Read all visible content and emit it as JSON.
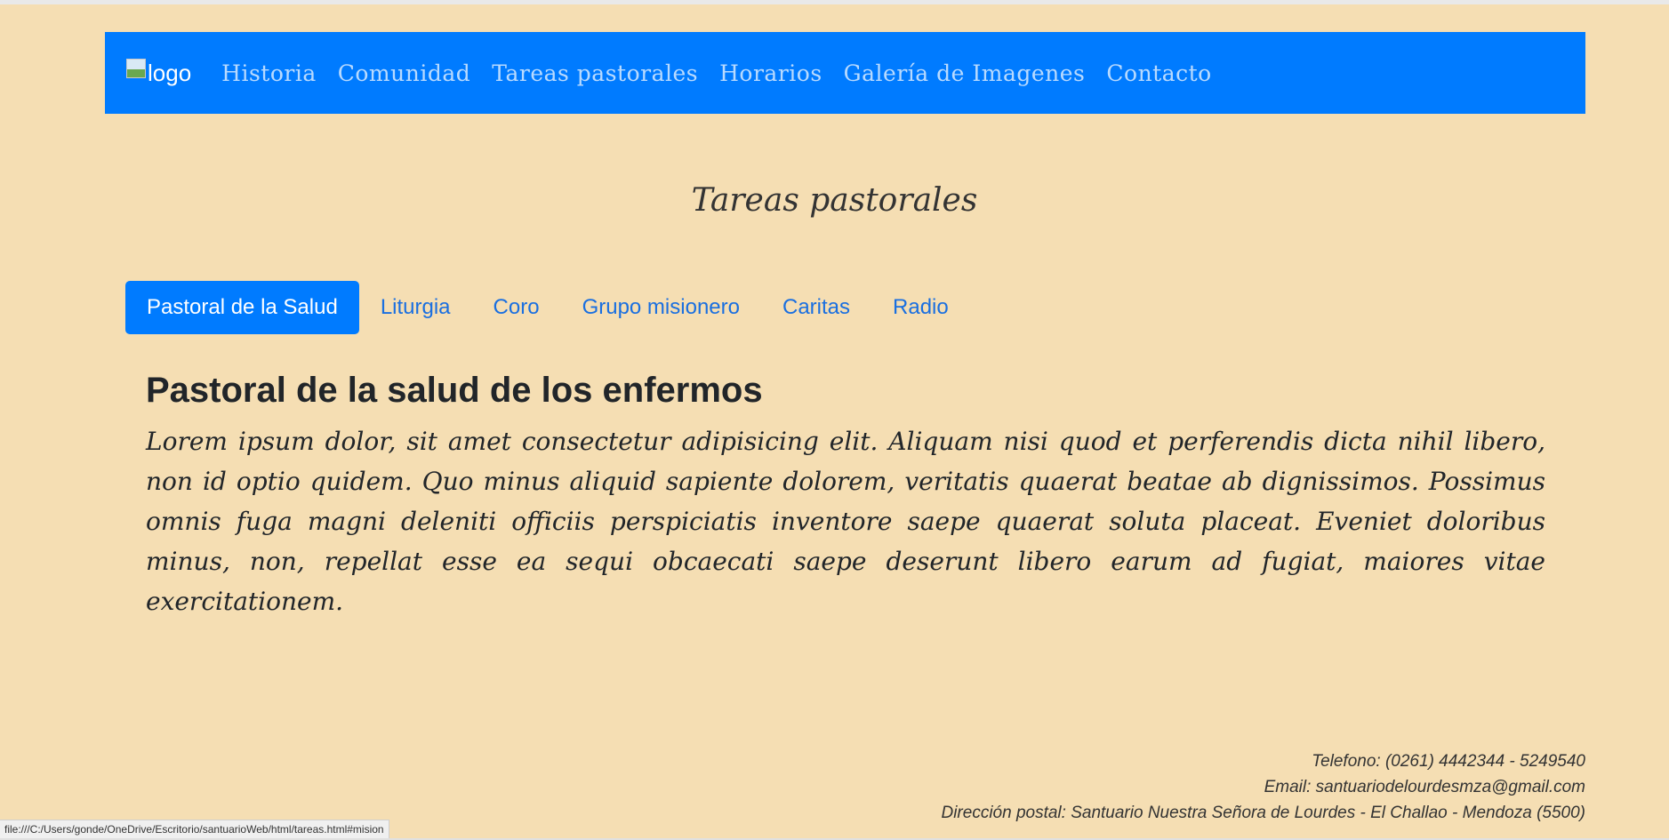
{
  "navbar": {
    "logo_alt": "logo",
    "items": [
      {
        "label": "Historia"
      },
      {
        "label": "Comunidad"
      },
      {
        "label": "Tareas pastorales"
      },
      {
        "label": "Horarios"
      },
      {
        "label": "Galería de Imagenes"
      },
      {
        "label": "Contacto"
      }
    ]
  },
  "page_title": "Tareas pastorales",
  "tabs": [
    {
      "label": "Pastoral de la Salud",
      "active": true
    },
    {
      "label": "Liturgia"
    },
    {
      "label": "Coro"
    },
    {
      "label": "Grupo misionero"
    },
    {
      "label": "Caritas"
    },
    {
      "label": "Radio"
    }
  ],
  "content": {
    "heading": "Pastoral de la salud de los enfermos",
    "body": "Lorem ipsum dolor, sit amet consectetur adipisicing elit. Aliquam nisi quod et perferendis dicta nihil libero, non id optio quidem. Quo minus aliquid sapiente dolorem, veritatis quaerat beatae ab dignissimos. Possimus omnis fuga magni deleniti officiis perspiciatis inventore saepe quaerat soluta placeat. Eveniet doloribus minus, non, repellat esse ea sequi obcaecati saepe deserunt libero earum ad fugiat, maiores vitae exercitationem."
  },
  "footer": {
    "phone": "Telefono: (0261) 4442344 - 5249540",
    "email": "Email: santuariodelourdesmza@gmail.com",
    "address": "Dirección postal: Santuario Nuestra Señora de Lourdes - El Challao - Mendoza (5500)"
  },
  "status_bar": {
    "url": "file:///C:/Users/gonde/OneDrive/Escritorio/santuarioWeb/html/tareas.html#mision"
  },
  "colors": {
    "background": "#f5deb3",
    "navbar": "#007bff",
    "active_tab": "#007bff",
    "tab_link": "#1a6fe0"
  }
}
